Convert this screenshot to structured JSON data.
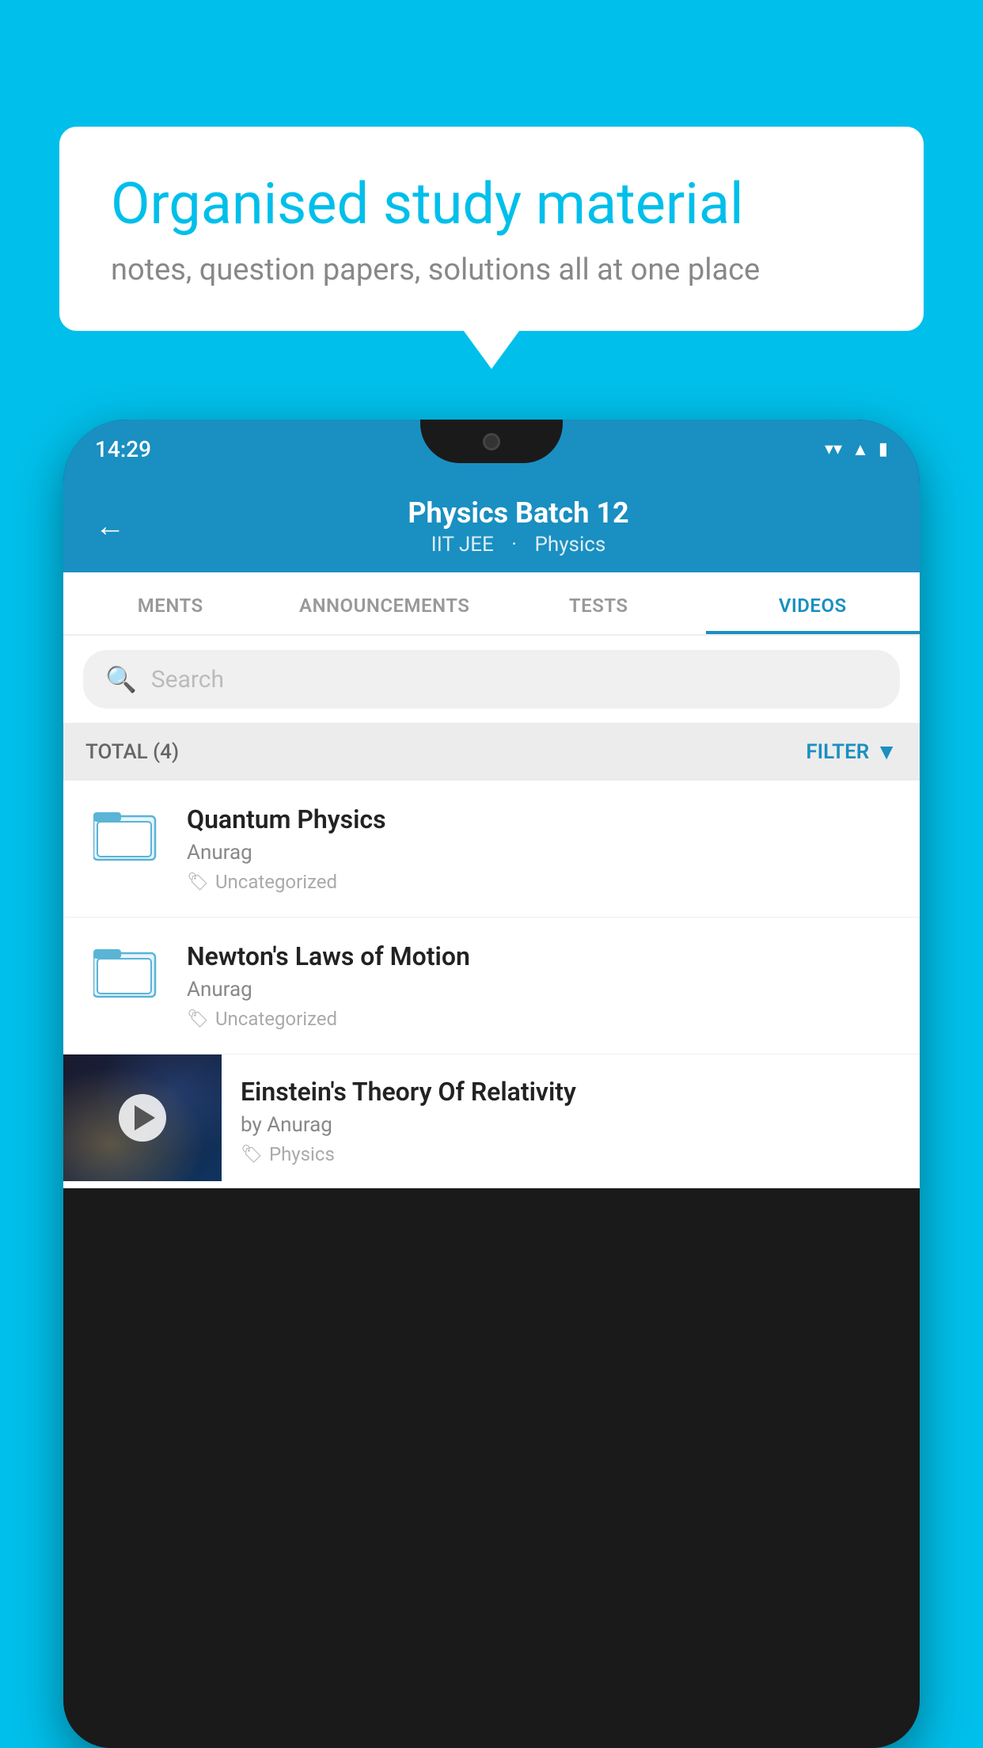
{
  "background_color": "#00BFEA",
  "speech_bubble": {
    "title": "Organised study material",
    "subtitle": "notes, question papers, solutions all at one place"
  },
  "phone": {
    "status_bar": {
      "time": "14:29",
      "icons": [
        "wifi",
        "signal",
        "battery"
      ]
    },
    "header": {
      "title": "Physics Batch 12",
      "subtitle_parts": [
        "IIT JEE",
        "Physics"
      ],
      "back_label": "←"
    },
    "tabs": [
      {
        "label": "MENTS",
        "active": false
      },
      {
        "label": "ANNOUNCEMENTS",
        "active": false
      },
      {
        "label": "TESTS",
        "active": false
      },
      {
        "label": "VIDEOS",
        "active": true
      }
    ],
    "search": {
      "placeholder": "Search"
    },
    "filter_bar": {
      "total_label": "TOTAL (4)",
      "filter_label": "FILTER"
    },
    "videos": [
      {
        "title": "Quantum Physics",
        "author": "Anurag",
        "tag": "Uncategorized",
        "type": "folder"
      },
      {
        "title": "Newton's Laws of Motion",
        "author": "Anurag",
        "tag": "Uncategorized",
        "type": "folder"
      },
      {
        "title": "Einstein's Theory Of Relativity",
        "author": "by Anurag",
        "tag": "Physics",
        "type": "video"
      }
    ]
  }
}
